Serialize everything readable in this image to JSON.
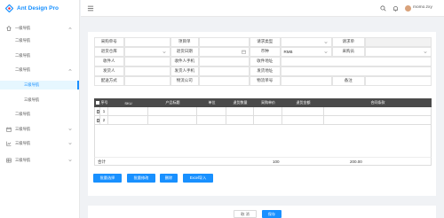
{
  "app": {
    "title": "Ant Design Pro"
  },
  "header": {
    "username": "momo.zxy"
  },
  "sidebar": {
    "items": [
      {
        "label": "一级导航",
        "active": false
      },
      {
        "label": "二级导航",
        "active": false
      },
      {
        "label": "二级导航",
        "active": false
      },
      {
        "label": "二级导航",
        "active": false
      },
      {
        "label": "三级导航",
        "active": true
      },
      {
        "label": "三级导航",
        "active": false
      },
      {
        "label": "二级导航",
        "active": false
      },
      {
        "label": "三级导航",
        "active": false
      },
      {
        "label": "三级导航",
        "active": false
      },
      {
        "label": "三级导航",
        "active": false
      }
    ]
  },
  "form": {
    "labels": {
      "purchase_no": "采购单号",
      "approval_no": "项目单",
      "request_type": "请求类型",
      "request_no": "请求单",
      "warehouse": "退货仓库",
      "return_date": "退货日期",
      "currency": "币种",
      "purchaser": "采购员",
      "receiver": "收件人",
      "receiver_phone": "收件人手机",
      "receive_addr": "收件地址",
      "sender": "发货人",
      "sender_phone": "发货人手机",
      "send_addr": "发货地址",
      "ship_method": "配送方式",
      "logistics": "物流公司",
      "tracking_no": "物流单号",
      "remark": "备注"
    },
    "values": {
      "currency": "RMB"
    }
  },
  "table": {
    "headers": [
      "序号",
      "SKU",
      "产品标题",
      "单位",
      "退货数量",
      "采购单价",
      "退货金额",
      "合同条款"
    ],
    "rows": [
      {
        "index": "1"
      },
      {
        "index": "2"
      }
    ],
    "totals": {
      "label": "合计",
      "quantity": "100",
      "amount": "200.00"
    }
  },
  "actions": {
    "batch_select": "批量选择",
    "batch_edit": "批量修改",
    "delete": "删除",
    "excel_import": "Excel导入"
  },
  "footer": {
    "cancel": "取 消",
    "save": "保存"
  },
  "colors": {
    "primary": "#1890ff",
    "header_dark": "#4a4a4a"
  }
}
